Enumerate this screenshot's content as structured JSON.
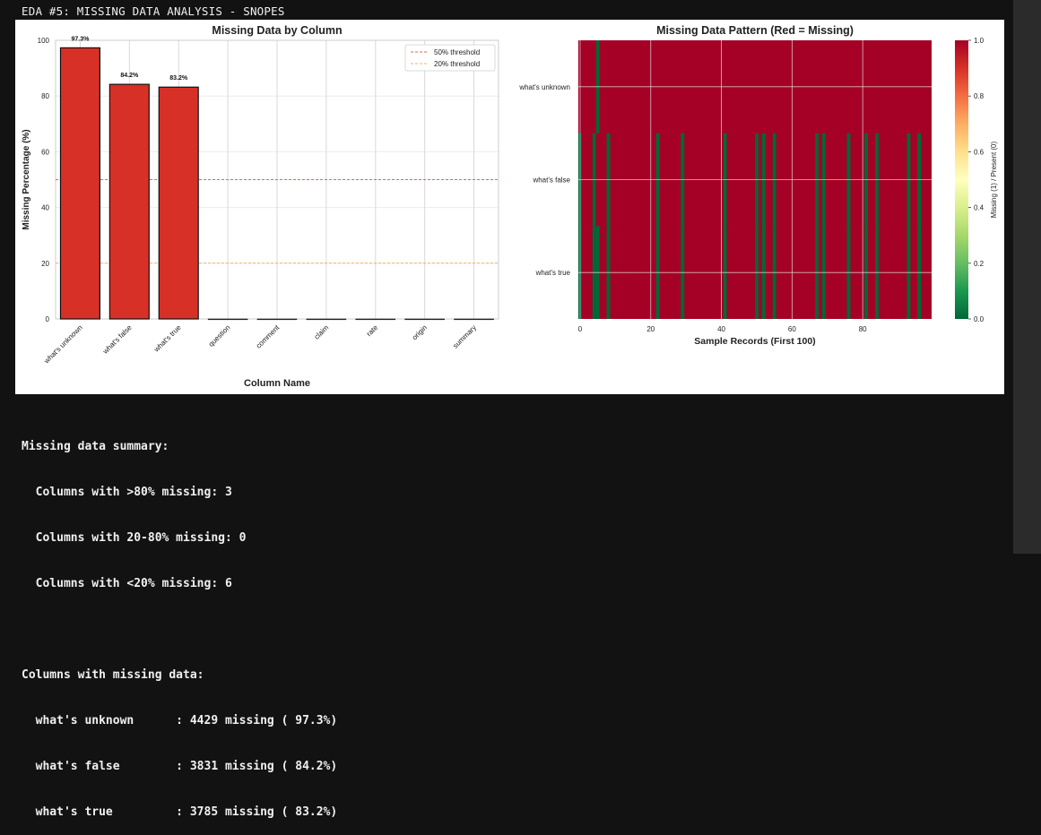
{
  "cell_header": "EDA #5: MISSING DATA ANALYSIS - SNOPES",
  "chart_data": [
    {
      "type": "bar",
      "title": "Missing Data by Column",
      "xlabel": "Column Name",
      "ylabel": "Missing Percentage (%)",
      "categories": [
        "what's unknown",
        "what's false",
        "what's true",
        "question",
        "comment",
        "claim",
        "rate",
        "origin",
        "summary"
      ],
      "values": [
        97.3,
        84.2,
        83.2,
        0,
        0,
        0,
        0,
        0,
        0
      ],
      "data_labels": [
        "97.3%",
        "84.2%",
        "83.2%"
      ],
      "ylim": [
        0,
        100
      ],
      "yticks": [
        0,
        20,
        40,
        60,
        80,
        100
      ],
      "grid": true,
      "bar_color": "#d73027",
      "thresholds": [
        {
          "label": "50% threshold",
          "value": 50,
          "color": "#e8625f"
        },
        {
          "label": "20% threshold",
          "value": 20,
          "color": "#f5b35e"
        }
      ],
      "legend_position": "top-right"
    },
    {
      "type": "heatmap",
      "title": "Missing Data Pattern (Red = Missing)",
      "xlabel": "Sample Records (First 100)",
      "rows": [
        "what's unknown",
        "what's false",
        "what's true"
      ],
      "n_columns": 100,
      "xticks": [
        0,
        20,
        40,
        60,
        80
      ],
      "present_records": {
        "what's unknown": [
          5
        ],
        "what's false": [
          0,
          4,
          8,
          22,
          29,
          41,
          50,
          52,
          55,
          67,
          69,
          76,
          81,
          84,
          93,
          96
        ],
        "what's true": [
          0,
          4,
          5,
          8,
          22,
          29,
          41,
          50,
          52,
          55,
          67,
          69,
          76,
          81,
          84,
          93,
          96
        ]
      },
      "colorbar": {
        "label": "Missing (1) / Present (0)",
        "ticks": [
          "0.0",
          "0.2",
          "0.4",
          "0.6",
          "0.8",
          "1.0"
        ],
        "missing_color": "#a50026",
        "present_color": "#006837"
      }
    }
  ],
  "output_lines": [
    "Missing data summary:",
    "  Columns with >80% missing: 3",
    "  Columns with 20-80% missing: 0",
    "  Columns with <20% missing: 6",
    "",
    "Columns with missing data:",
    "  what's unknown      : 4429 missing ( 97.3%)",
    "  what's false        : 3831 missing ( 84.2%)",
    "  what's true         : 3785 missing ( 83.2%)"
  ]
}
